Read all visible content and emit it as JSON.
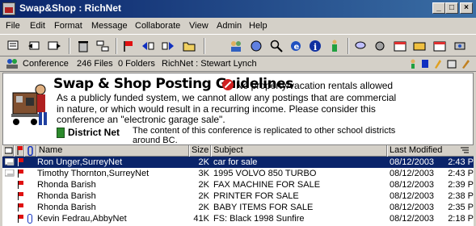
{
  "window": {
    "title": "Swap&Shop : RichNet",
    "min_label": "_",
    "max_label": "□",
    "close_label": "×"
  },
  "menu": [
    "File",
    "Edit",
    "Format",
    "Message",
    "Collaborate",
    "View",
    "Admin",
    "Help"
  ],
  "info": {
    "conference_label": "Conference",
    "files": "246 Files",
    "folders": "0 Folders",
    "location": "RichNet : Stewart Lynch"
  },
  "banner": {
    "heading": "Swap & Shop Posting Guidelines",
    "warning": "No property/vacation rentals allowed",
    "body": "As a publicly funded system, we cannot allow any postings that are commercial in nature, or which would result in a recurring income.  Please consider this conference an \"electronic garage sale\".",
    "district": "District Net",
    "note": "The content of this conference is replicated to other school districts around BC."
  },
  "columns": {
    "name": "Name",
    "size": "Size",
    "subject": "Subject",
    "modified": "Last Modified"
  },
  "rows": [
    {
      "name": "Ron Unger,SurreyNet",
      "size": "2K",
      "subject": "car for sale",
      "date": "08/12/2003",
      "time": "2:43 P"
    },
    {
      "name": "Timothy Thornton,SurreyNet",
      "size": "3K",
      "subject": "1995 VOLVO 850 TURBO",
      "date": "08/12/2003",
      "time": "2:43 P"
    },
    {
      "name": "Rhonda Barish",
      "size": "2K",
      "subject": "FAX MACHINE FOR SALE",
      "date": "08/12/2003",
      "time": "2:39 P"
    },
    {
      "name": "Rhonda Barish",
      "size": "2K",
      "subject": "PRINTER FOR SALE",
      "date": "08/12/2003",
      "time": "2:38 P"
    },
    {
      "name": "Rhonda Barish",
      "size": "2K",
      "subject": "BABY ITEMS FOR SALE",
      "date": "08/12/2003",
      "time": "2:35 P"
    },
    {
      "name": "Kevin Fedrau,AbbyNet",
      "size": "41K",
      "subject": "FS: Black 1998 Sunfire",
      "date": "08/12/2003",
      "time": "2:18 P"
    }
  ],
  "colors": {
    "selection": "#0a246a",
    "flag": "#e01010",
    "titlebar": "#0a246a"
  }
}
